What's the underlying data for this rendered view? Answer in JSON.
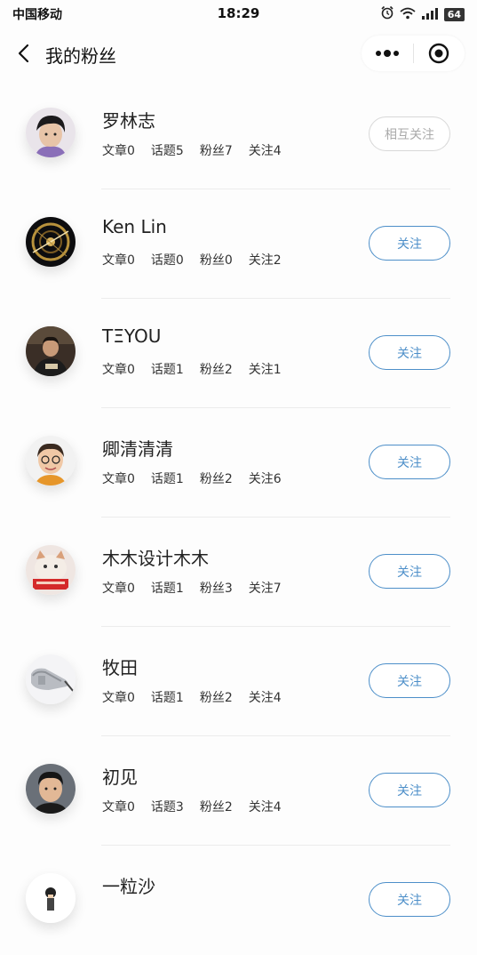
{
  "status_bar": {
    "carrier": "中国移动",
    "time": "18:29",
    "battery": "64",
    "icons": [
      "alarm-icon",
      "wifi-icon",
      "signal-icon",
      "battery-icon"
    ]
  },
  "nav": {
    "title": "我的粉丝",
    "back_icon": "chevron-left-icon",
    "more_icon": "more-dots-icon",
    "close_icon": "target-close-icon"
  },
  "colors": {
    "accent": "#4d8fc9",
    "muted_border": "#d8d8d8",
    "muted_text": "#aaaaaa"
  },
  "followers": [
    {
      "name": "罗林志",
      "stats": [
        "文章0",
        "话题5",
        "粉丝7",
        "关注4"
      ],
      "button": "相互关注",
      "mutual": true
    },
    {
      "name": "Ken Lin",
      "stats": [
        "文章0",
        "话题0",
        "粉丝0",
        "关注2"
      ],
      "button": "关注",
      "mutual": false
    },
    {
      "name": "TΞYOU",
      "stats": [
        "文章0",
        "话题1",
        "粉丝2",
        "关注1"
      ],
      "button": "关注",
      "mutual": false
    },
    {
      "name": "卿清清清",
      "stats": [
        "文章0",
        "话题1",
        "粉丝2",
        "关注6"
      ],
      "button": "关注",
      "mutual": false
    },
    {
      "name": "木木设计木木",
      "stats": [
        "文章0",
        "话题1",
        "粉丝3",
        "关注7"
      ],
      "button": "关注",
      "mutual": false
    },
    {
      "name": "牧田",
      "stats": [
        "文章0",
        "话题1",
        "粉丝2",
        "关注4"
      ],
      "button": "关注",
      "mutual": false
    },
    {
      "name": "初见",
      "stats": [
        "文章0",
        "话题3",
        "粉丝2",
        "关注4"
      ],
      "button": "关注",
      "mutual": false
    },
    {
      "name": "一粒沙",
      "stats": [
        "",
        "",
        "",
        ""
      ],
      "button": "关注",
      "mutual": false
    }
  ]
}
